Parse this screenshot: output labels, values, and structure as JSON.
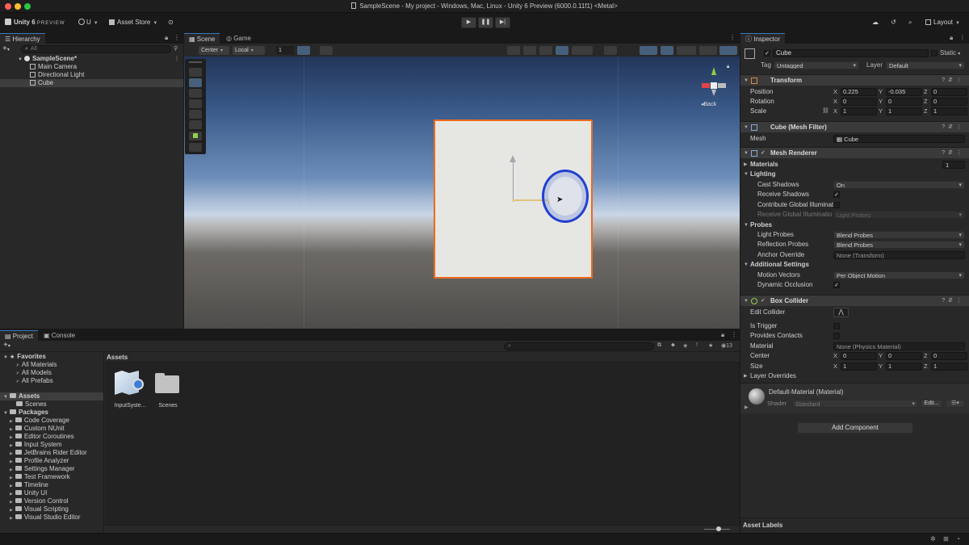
{
  "window": {
    "title": "SampleScene - My project - Windows, Mac, Linux - Unity 6 Preview (6000.0.11f1) <Metal>"
  },
  "toolbar": {
    "unity_label": "Unity 6",
    "preview_label": "PREVIEW",
    "account_label": "U",
    "asset_store_label": "Asset Store",
    "layout_label": "Layout"
  },
  "hierarchy": {
    "tab_label": "Hierarchy",
    "search_placeholder": "All",
    "scene_name": "SampleScene*",
    "items": [
      "Main Camera",
      "Directional Light",
      "Cube"
    ]
  },
  "scene": {
    "tabs": [
      "Scene",
      "Game"
    ],
    "pivot_label": "Center",
    "space_label": "Local",
    "grid_value": "1",
    "orientation_label": "Back"
  },
  "inspector": {
    "tab_label": "Inspector",
    "object_name": "Cube",
    "static_label": "Static",
    "tag_label": "Tag",
    "tag_value": "Untagged",
    "layer_label": "Layer",
    "layer_value": "Default",
    "transform": {
      "title": "Transform",
      "position_label": "Position",
      "rotation_label": "Rotation",
      "scale_label": "Scale",
      "position": {
        "x": "0.225",
        "y": "-0.035",
        "z": "0"
      },
      "rotation": {
        "x": "0",
        "y": "0",
        "z": "0"
      },
      "scale": {
        "x": "1",
        "y": "1",
        "z": "1"
      }
    },
    "mesh_filter": {
      "title": "Cube (Mesh Filter)",
      "mesh_label": "Mesh",
      "mesh_value": "Cube"
    },
    "mesh_renderer": {
      "title": "Mesh Renderer",
      "materials_label": "Materials",
      "materials_count": "1",
      "lighting_label": "Lighting",
      "cast_shadows_label": "Cast Shadows",
      "cast_shadows_value": "On",
      "receive_shadows_label": "Receive Shadows",
      "contribute_gi_label": "Contribute Global Illuminati",
      "receive_gi_label": "Receive Global Illuminatio",
      "receive_gi_value": "Light Probes",
      "probes_label": "Probes",
      "light_probes_label": "Light Probes",
      "light_probes_value": "Blend Probes",
      "reflection_probes_label": "Reflection Probes",
      "reflection_probes_value": "Blend Probes",
      "anchor_override_label": "Anchor Override",
      "anchor_override_value": "None (Transform)",
      "additional_label": "Additional Settings",
      "motion_vectors_label": "Motion Vectors",
      "motion_vectors_value": "Per Object Motion",
      "dynamic_occlusion_label": "Dynamic Occlusion"
    },
    "box_collider": {
      "title": "Box Collider",
      "edit_collider_label": "Edit Collider",
      "is_trigger_label": "Is Trigger",
      "provides_contacts_label": "Provides Contacts",
      "material_label": "Material",
      "material_value": "None (Physics Material)",
      "center_label": "Center",
      "size_label": "Size",
      "center": {
        "x": "0",
        "y": "0",
        "z": "0"
      },
      "size": {
        "x": "1",
        "y": "1",
        "z": "1"
      },
      "layer_overrides_label": "Layer Overrides"
    },
    "material": {
      "name": "Default-Material (Material)",
      "shader_label": "Shader",
      "shader_value": "Standard",
      "edit_label": "Edit..."
    },
    "add_component_label": "Add Component",
    "asset_labels_label": "Asset Labels"
  },
  "project": {
    "tabs": [
      "Project",
      "Console"
    ],
    "search_count": "13",
    "favorites_label": "Favorites",
    "favorites": [
      "All Materials",
      "All Models",
      "All Prefabs"
    ],
    "assets_label": "Assets",
    "assets_children": [
      "Scenes"
    ],
    "packages_label": "Packages",
    "packages": [
      "Code Coverage",
      "Custom NUnit",
      "Editor Coroutines",
      "Input System",
      "JetBrains Rider Editor",
      "Profile Analyzer",
      "Settings Manager",
      "Test Framework",
      "Timeline",
      "Unity UI",
      "Version Control",
      "Visual Scripting",
      "Visual Studio Editor"
    ],
    "breadcrumb": "Assets",
    "grid_items": [
      "InputSyste...",
      "Scenes"
    ]
  }
}
